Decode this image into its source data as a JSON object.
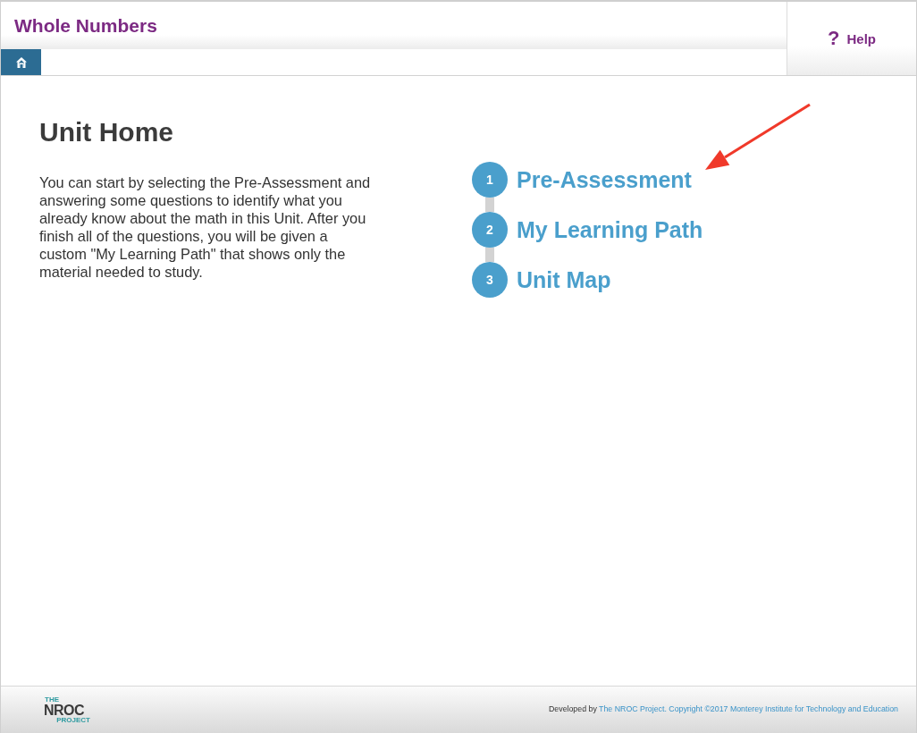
{
  "header": {
    "title": "Whole Numbers",
    "help_button": {
      "symbol": "?",
      "label": "Help"
    }
  },
  "main": {
    "heading": "Unit Home",
    "intro": "You can start by selecting the Pre-Assessment and answering some questions to identify what you already know about the math in this Unit. After you finish all of the questions, you will be given a custom \"My Learning Path\" that shows only the material needed to study.",
    "steps": [
      {
        "number": "1",
        "label": "Pre-Assessment"
      },
      {
        "number": "2",
        "label": "My Learning Path"
      },
      {
        "number": "3",
        "label": "Unit Map"
      }
    ]
  },
  "footer": {
    "logo": {
      "line_1": "THE",
      "line_2": "NROC",
      "line_3": "PROJECT"
    },
    "credit_prefix": "Developed by",
    "credit_link": "The NROC Project",
    "credit_suffix": ". Copyright ©2017 Monterey Institute for Technology and Education"
  }
}
